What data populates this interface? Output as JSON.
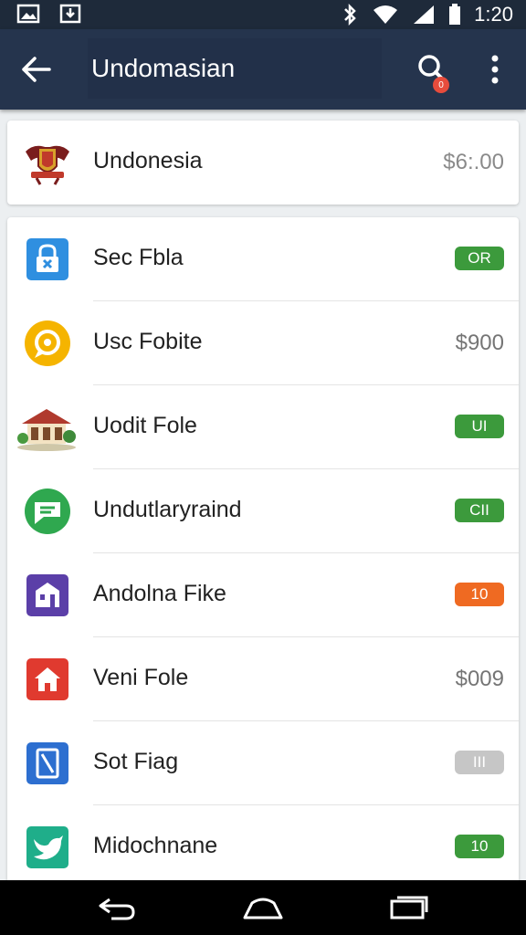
{
  "status_bar": {
    "time": "1:20",
    "icons": [
      "image-icon",
      "download-icon",
      "bluetooth-icon",
      "wifi-icon",
      "signal-icon",
      "battery-icon"
    ]
  },
  "app_bar": {
    "title": "Undomasian",
    "notification_count": "0",
    "back_icon": "arrow-left-icon",
    "search_icon": "search-icon",
    "more_icon": "more-vert-icon"
  },
  "header": {
    "icon": "coat-of-arms-icon",
    "name": "Undonesia",
    "amount": "$6:.00"
  },
  "items": [
    {
      "label": "Sec Fbla",
      "icon": "lock-icon",
      "icon_color": "#2f8fe0",
      "badge": "OR",
      "badge_color": "#3c9a3c",
      "price": ""
    },
    {
      "label": "Usc Fobite",
      "icon": "chat-icon",
      "icon_color": "#f5b400",
      "badge": "",
      "badge_color": "",
      "price": "$900"
    },
    {
      "label": "Uodit Fole",
      "icon": "house-icon",
      "icon_color": "#b03a2e",
      "badge": "UI",
      "badge_color": "#3c9a3c",
      "price": ""
    },
    {
      "label": "Undutlaryraind",
      "icon": "message-icon",
      "icon_color": "#2fa84f",
      "badge": "CII",
      "badge_color": "#3c9a3c",
      "price": ""
    },
    {
      "label": "Andolna Fike",
      "icon": "building-icon",
      "icon_color": "#5b3fa8",
      "badge": "10",
      "badge_color": "#ef6a22",
      "price": ""
    },
    {
      "label": "Veni Fole",
      "icon": "home-icon",
      "icon_color": "#e03a2f",
      "badge": "",
      "badge_color": "",
      "price": "$009"
    },
    {
      "label": "Sot Fiag",
      "icon": "file-icon",
      "icon_color": "#2d6fd0",
      "badge": "III",
      "badge_color": "#c6c6c6",
      "price": ""
    },
    {
      "label": "Midochnane",
      "icon": "bird-icon",
      "icon_color": "#1fae8a",
      "badge": "10",
      "badge_color": "#3c9a3c",
      "price": ""
    }
  ],
  "nav_bar": {
    "back_icon": "nav-back-icon",
    "home_icon": "nav-home-icon",
    "recents_icon": "nav-recents-icon"
  }
}
